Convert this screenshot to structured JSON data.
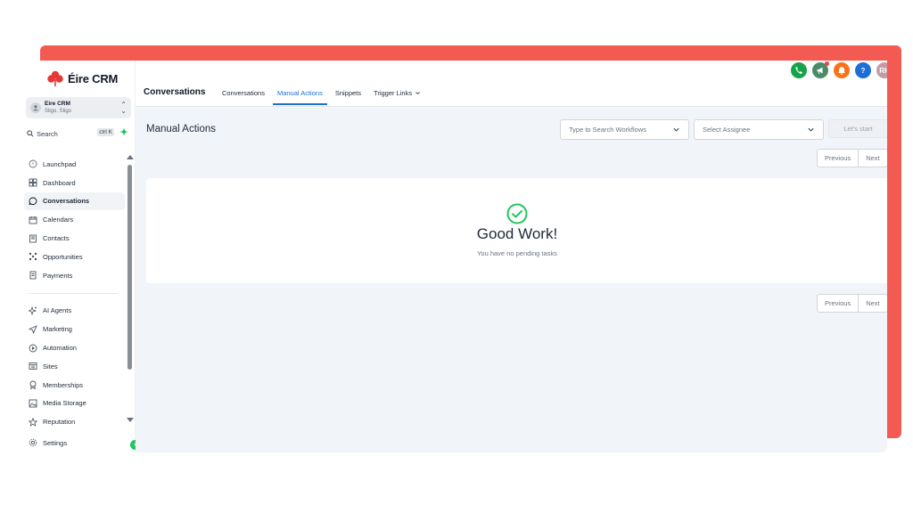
{
  "brand": {
    "name": "Éire CRM",
    "accent": "#f25a52",
    "primary": "#1d6fd6",
    "success": "#22c55e"
  },
  "account": {
    "name": "Eire CRM",
    "location": "Sligo, Sligo"
  },
  "search": {
    "label": "Search",
    "shortcut": "ctrl K"
  },
  "sidebar": {
    "items": [
      {
        "label": "Launchpad",
        "icon": "rocket-icon"
      },
      {
        "label": "Dashboard",
        "icon": "dashboard-icon"
      },
      {
        "label": "Conversations",
        "icon": "chat-icon",
        "active": true
      },
      {
        "label": "Calendars",
        "icon": "calendar-icon"
      },
      {
        "label": "Contacts",
        "icon": "contacts-icon"
      },
      {
        "label": "Opportunities",
        "icon": "opportunities-icon"
      },
      {
        "label": "Payments",
        "icon": "payments-icon"
      }
    ],
    "items2": [
      {
        "label": "AI Agents",
        "icon": "sparkle-icon"
      },
      {
        "label": "Marketing",
        "icon": "send-icon"
      },
      {
        "label": "Automation",
        "icon": "automation-icon"
      },
      {
        "label": "Sites",
        "icon": "sites-icon"
      },
      {
        "label": "Memberships",
        "icon": "award-icon"
      },
      {
        "label": "Media Storage",
        "icon": "image-icon"
      },
      {
        "label": "Reputation",
        "icon": "star-icon"
      }
    ],
    "settings": "Settings"
  },
  "header": {
    "title": "Conversations",
    "tabs": [
      {
        "label": "Conversations"
      },
      {
        "label": "Manual Actions",
        "active": true
      },
      {
        "label": "Snippets"
      },
      {
        "label": "Trigger Links",
        "dropdown": true
      }
    ],
    "avatar_initials": "RH"
  },
  "main": {
    "title": "Manual Actions",
    "workflow_select_placeholder": "Type to Search Workflows",
    "assignee_select_placeholder": "Select Assignee",
    "start_button": "Let's start",
    "pager": {
      "previous": "Previous",
      "next": "Next"
    },
    "empty_state": {
      "title": "Good Work!",
      "subtitle": "You have no pending tasks"
    }
  }
}
